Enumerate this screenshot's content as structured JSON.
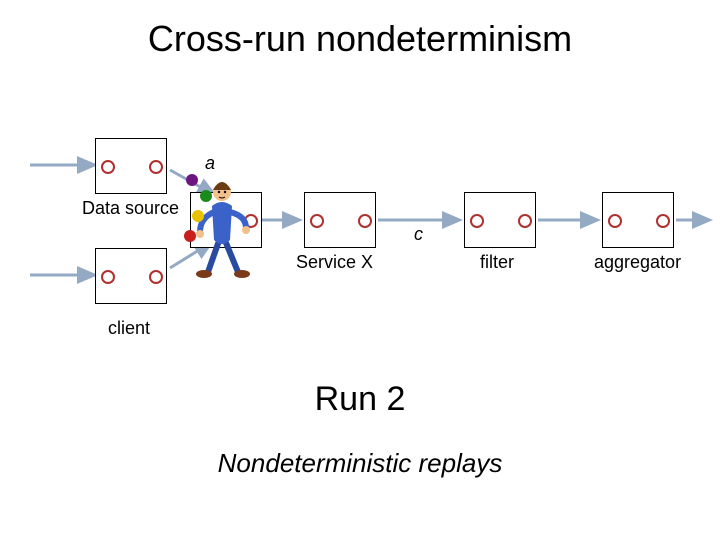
{
  "title": "Cross-run nondeterminism",
  "labels": {
    "data_source": "Data source",
    "service_x": "Service X",
    "filter": "filter",
    "aggregator": "aggregator",
    "client": "client",
    "a": "a",
    "c": "c"
  },
  "run_label": "Run 2",
  "footer": "Nondeterministic replays",
  "colors": {
    "port": "#b03030",
    "arrow": "#93a9c4"
  }
}
